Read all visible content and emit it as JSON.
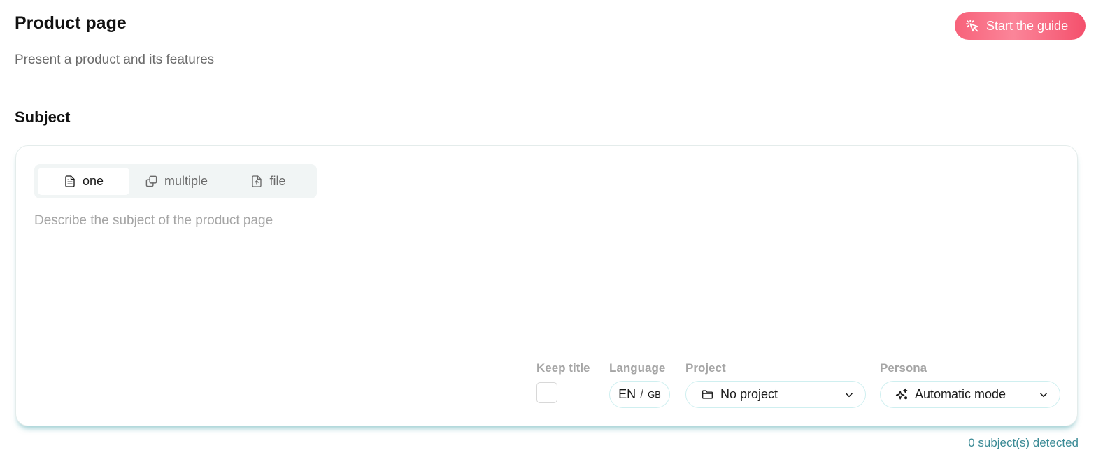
{
  "header": {
    "title": "Product page",
    "subtitle": "Present a product and its features",
    "guide_button": "Start the guide"
  },
  "subject": {
    "section_title": "Subject",
    "tabs": [
      {
        "label": "one",
        "icon": "document-icon",
        "active": true
      },
      {
        "label": "multiple",
        "icon": "copy-icon",
        "active": false
      },
      {
        "label": "file",
        "icon": "file-upload-icon",
        "active": false
      }
    ],
    "input": {
      "value": "",
      "placeholder": "Describe the subject of the product page"
    },
    "options": {
      "keep_title": {
        "label": "Keep title",
        "checked": false
      },
      "language": {
        "label": "Language",
        "code": "EN",
        "region": "GB"
      },
      "project": {
        "label": "Project",
        "value": "No project",
        "icon": "folder-icon"
      },
      "persona": {
        "label": "Persona",
        "value": "Automatic mode",
        "icon": "sparkles-icon"
      }
    },
    "detected": "0 subject(s) detected"
  },
  "colors": {
    "accent_gradient_start": "#f7627a",
    "accent_gradient_end": "#f4506c",
    "teal_text": "#3a8a95",
    "pill_border": "#cfeff0"
  }
}
